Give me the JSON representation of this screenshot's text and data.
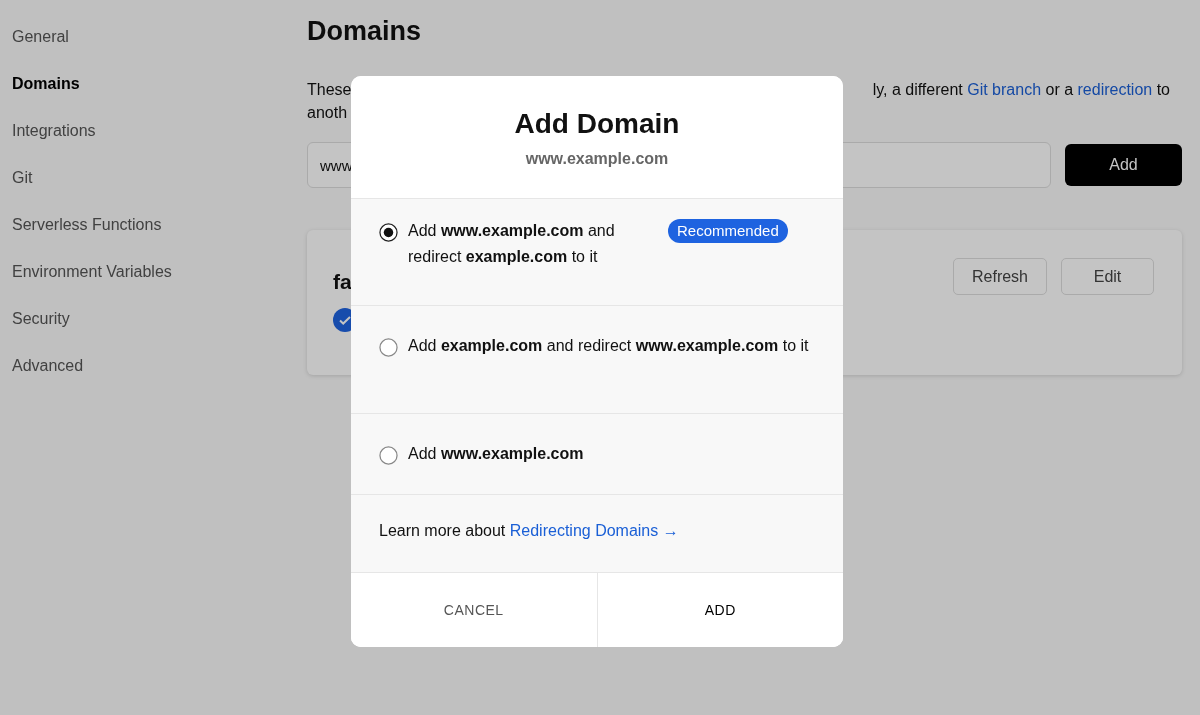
{
  "sidebar": {
    "items": [
      {
        "label": "General",
        "selected": false
      },
      {
        "label": "Domains",
        "selected": true
      },
      {
        "label": "Integrations",
        "selected": false
      },
      {
        "label": "Git",
        "selected": false
      },
      {
        "label": "Serverless Functions",
        "selected": false
      },
      {
        "label": "Environment Variables",
        "selected": false
      },
      {
        "label": "Security",
        "selected": false
      },
      {
        "label": "Advanced",
        "selected": false
      }
    ]
  },
  "main": {
    "title": "Domains",
    "description": {
      "line_1_start": "These",
      "line_1_end": [
        {
          "text": "ly, a different ",
          "link": false
        },
        {
          "text": "Git branch",
          "link": true
        },
        {
          "text": " or a ",
          "link": false
        },
        {
          "text": "redirection",
          "link": true
        },
        {
          "text": " to",
          "link": false
        }
      ],
      "line_2_start": "anoth"
    },
    "domain_input": {
      "value": "www"
    },
    "add_button": "Add",
    "domain_card": {
      "title": "fa",
      "verified": true,
      "buttons": [
        "Refresh",
        "Edit"
      ]
    }
  },
  "modal": {
    "title": "Add Domain",
    "subtitle": "www.example.com",
    "options": [
      {
        "text": "Add **www.example.com** and redirect **example.com** to it",
        "selected": true,
        "badge": "Recommended"
      },
      {
        "text": "Add **example.com** and redirect **www.example.com** to it",
        "selected": false
      },
      {
        "text": "Add **www.example.com**",
        "selected": false
      }
    ],
    "learn_more": {
      "text": "Learn more about ",
      "link": "Redirecting Domains →"
    },
    "buttons": [
      {
        "label": "CANCEL",
        "kind": "secondary"
      },
      {
        "label": "ADD",
        "kind": "primary"
      }
    ]
  }
}
